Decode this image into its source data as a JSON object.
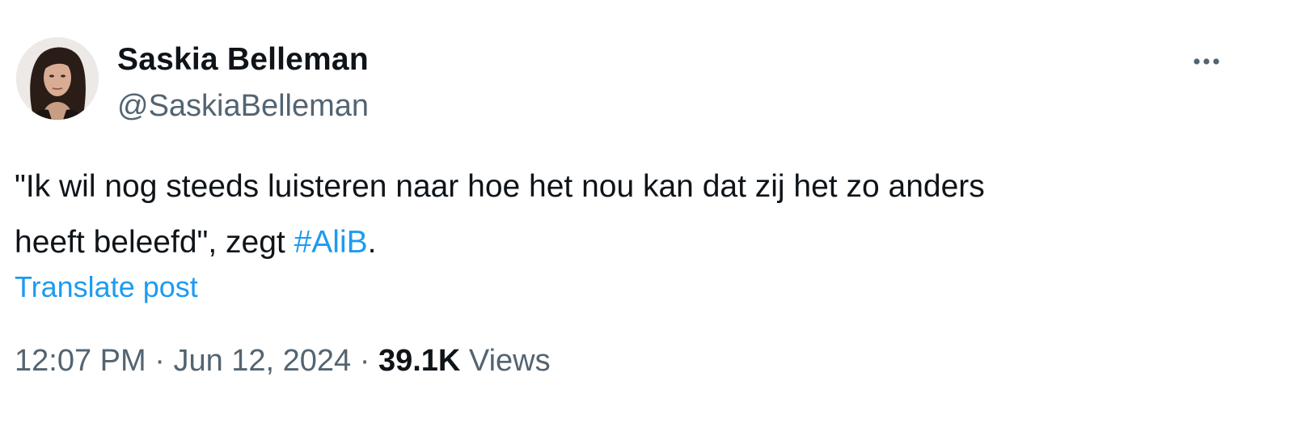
{
  "tweet": {
    "author": {
      "name": "Saskia Belleman",
      "handle": "@SaskiaBelleman"
    },
    "text_line1": "\"Ik wil nog steeds luisteren naar hoe het nou kan dat zij het zo anders",
    "text_line2_before": "heeft beleefd\", zegt ",
    "hashtag": "#AliB",
    "text_line2_after": ".",
    "translate_label": "Translate post",
    "time": "12:07 PM",
    "separator": " · ",
    "date": "Jun 12, 2024",
    "views_count": "39.1K",
    "views_label": " Views"
  },
  "icons": {
    "more": "more-horizontal-icon"
  },
  "colors": {
    "text": "#0f1419",
    "secondary": "#536471",
    "accent": "#1d9bf0"
  }
}
